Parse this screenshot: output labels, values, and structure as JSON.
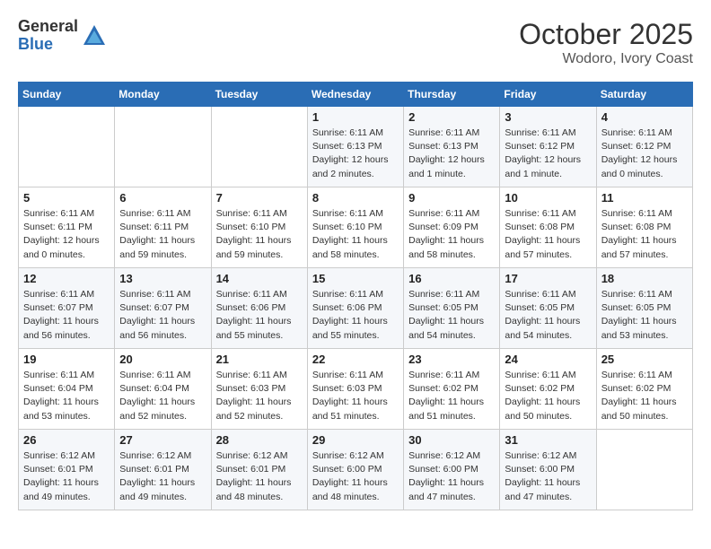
{
  "logo": {
    "general": "General",
    "blue": "Blue"
  },
  "title": "October 2025",
  "subtitle": "Wodoro, Ivory Coast",
  "days_of_week": [
    "Sunday",
    "Monday",
    "Tuesday",
    "Wednesday",
    "Thursday",
    "Friday",
    "Saturday"
  ],
  "weeks": [
    [
      {
        "day": "",
        "info": ""
      },
      {
        "day": "",
        "info": ""
      },
      {
        "day": "",
        "info": ""
      },
      {
        "day": "1",
        "info": "Sunrise: 6:11 AM\nSunset: 6:13 PM\nDaylight: 12 hours\nand 2 minutes."
      },
      {
        "day": "2",
        "info": "Sunrise: 6:11 AM\nSunset: 6:13 PM\nDaylight: 12 hours\nand 1 minute."
      },
      {
        "day": "3",
        "info": "Sunrise: 6:11 AM\nSunset: 6:12 PM\nDaylight: 12 hours\nand 1 minute."
      },
      {
        "day": "4",
        "info": "Sunrise: 6:11 AM\nSunset: 6:12 PM\nDaylight: 12 hours\nand 0 minutes."
      }
    ],
    [
      {
        "day": "5",
        "info": "Sunrise: 6:11 AM\nSunset: 6:11 PM\nDaylight: 12 hours\nand 0 minutes."
      },
      {
        "day": "6",
        "info": "Sunrise: 6:11 AM\nSunset: 6:11 PM\nDaylight: 11 hours\nand 59 minutes."
      },
      {
        "day": "7",
        "info": "Sunrise: 6:11 AM\nSunset: 6:10 PM\nDaylight: 11 hours\nand 59 minutes."
      },
      {
        "day": "8",
        "info": "Sunrise: 6:11 AM\nSunset: 6:10 PM\nDaylight: 11 hours\nand 58 minutes."
      },
      {
        "day": "9",
        "info": "Sunrise: 6:11 AM\nSunset: 6:09 PM\nDaylight: 11 hours\nand 58 minutes."
      },
      {
        "day": "10",
        "info": "Sunrise: 6:11 AM\nSunset: 6:08 PM\nDaylight: 11 hours\nand 57 minutes."
      },
      {
        "day": "11",
        "info": "Sunrise: 6:11 AM\nSunset: 6:08 PM\nDaylight: 11 hours\nand 57 minutes."
      }
    ],
    [
      {
        "day": "12",
        "info": "Sunrise: 6:11 AM\nSunset: 6:07 PM\nDaylight: 11 hours\nand 56 minutes."
      },
      {
        "day": "13",
        "info": "Sunrise: 6:11 AM\nSunset: 6:07 PM\nDaylight: 11 hours\nand 56 minutes."
      },
      {
        "day": "14",
        "info": "Sunrise: 6:11 AM\nSunset: 6:06 PM\nDaylight: 11 hours\nand 55 minutes."
      },
      {
        "day": "15",
        "info": "Sunrise: 6:11 AM\nSunset: 6:06 PM\nDaylight: 11 hours\nand 55 minutes."
      },
      {
        "day": "16",
        "info": "Sunrise: 6:11 AM\nSunset: 6:05 PM\nDaylight: 11 hours\nand 54 minutes."
      },
      {
        "day": "17",
        "info": "Sunrise: 6:11 AM\nSunset: 6:05 PM\nDaylight: 11 hours\nand 54 minutes."
      },
      {
        "day": "18",
        "info": "Sunrise: 6:11 AM\nSunset: 6:05 PM\nDaylight: 11 hours\nand 53 minutes."
      }
    ],
    [
      {
        "day": "19",
        "info": "Sunrise: 6:11 AM\nSunset: 6:04 PM\nDaylight: 11 hours\nand 53 minutes."
      },
      {
        "day": "20",
        "info": "Sunrise: 6:11 AM\nSunset: 6:04 PM\nDaylight: 11 hours\nand 52 minutes."
      },
      {
        "day": "21",
        "info": "Sunrise: 6:11 AM\nSunset: 6:03 PM\nDaylight: 11 hours\nand 52 minutes."
      },
      {
        "day": "22",
        "info": "Sunrise: 6:11 AM\nSunset: 6:03 PM\nDaylight: 11 hours\nand 51 minutes."
      },
      {
        "day": "23",
        "info": "Sunrise: 6:11 AM\nSunset: 6:02 PM\nDaylight: 11 hours\nand 51 minutes."
      },
      {
        "day": "24",
        "info": "Sunrise: 6:11 AM\nSunset: 6:02 PM\nDaylight: 11 hours\nand 50 minutes."
      },
      {
        "day": "25",
        "info": "Sunrise: 6:11 AM\nSunset: 6:02 PM\nDaylight: 11 hours\nand 50 minutes."
      }
    ],
    [
      {
        "day": "26",
        "info": "Sunrise: 6:12 AM\nSunset: 6:01 PM\nDaylight: 11 hours\nand 49 minutes."
      },
      {
        "day": "27",
        "info": "Sunrise: 6:12 AM\nSunset: 6:01 PM\nDaylight: 11 hours\nand 49 minutes."
      },
      {
        "day": "28",
        "info": "Sunrise: 6:12 AM\nSunset: 6:01 PM\nDaylight: 11 hours\nand 48 minutes."
      },
      {
        "day": "29",
        "info": "Sunrise: 6:12 AM\nSunset: 6:00 PM\nDaylight: 11 hours\nand 48 minutes."
      },
      {
        "day": "30",
        "info": "Sunrise: 6:12 AM\nSunset: 6:00 PM\nDaylight: 11 hours\nand 47 minutes."
      },
      {
        "day": "31",
        "info": "Sunrise: 6:12 AM\nSunset: 6:00 PM\nDaylight: 11 hours\nand 47 minutes."
      },
      {
        "day": "",
        "info": ""
      }
    ]
  ]
}
